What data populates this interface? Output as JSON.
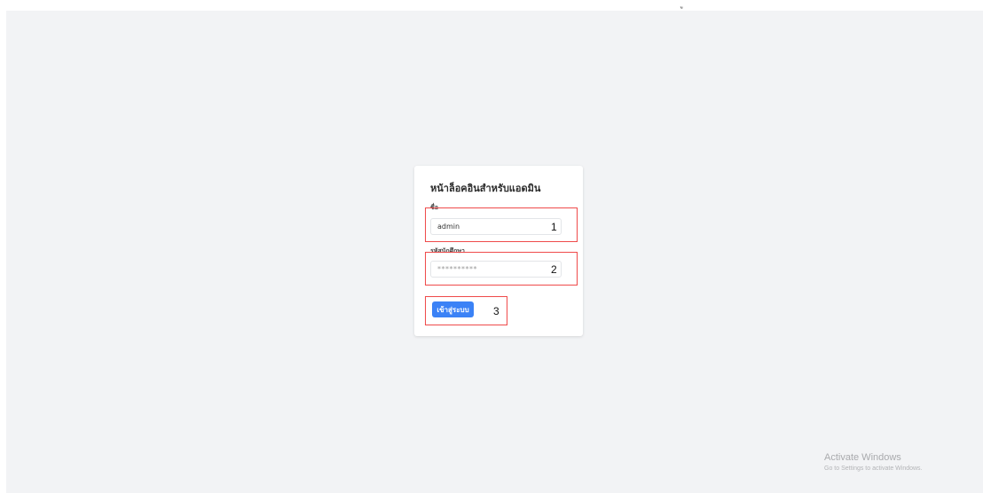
{
  "top_mark": "ู",
  "login": {
    "title": "หน้าล็อคอินสำหรับแอดมิน",
    "username_label": "ชื่อ",
    "username_value": "admin",
    "password_label": "รหัสนักศึกษา",
    "password_value": "**********",
    "submit_label": "เข้าสู่ระบบ"
  },
  "annotations": {
    "one": "1",
    "two": "2",
    "three": "3",
    "color": "#ef4b4b"
  },
  "watermark": {
    "title": "Activate Windows",
    "subtitle": "Go to Settings to activate Windows."
  },
  "colors": {
    "background": "#f2f3f5",
    "card": "#ffffff",
    "button": "#3b82f6"
  }
}
